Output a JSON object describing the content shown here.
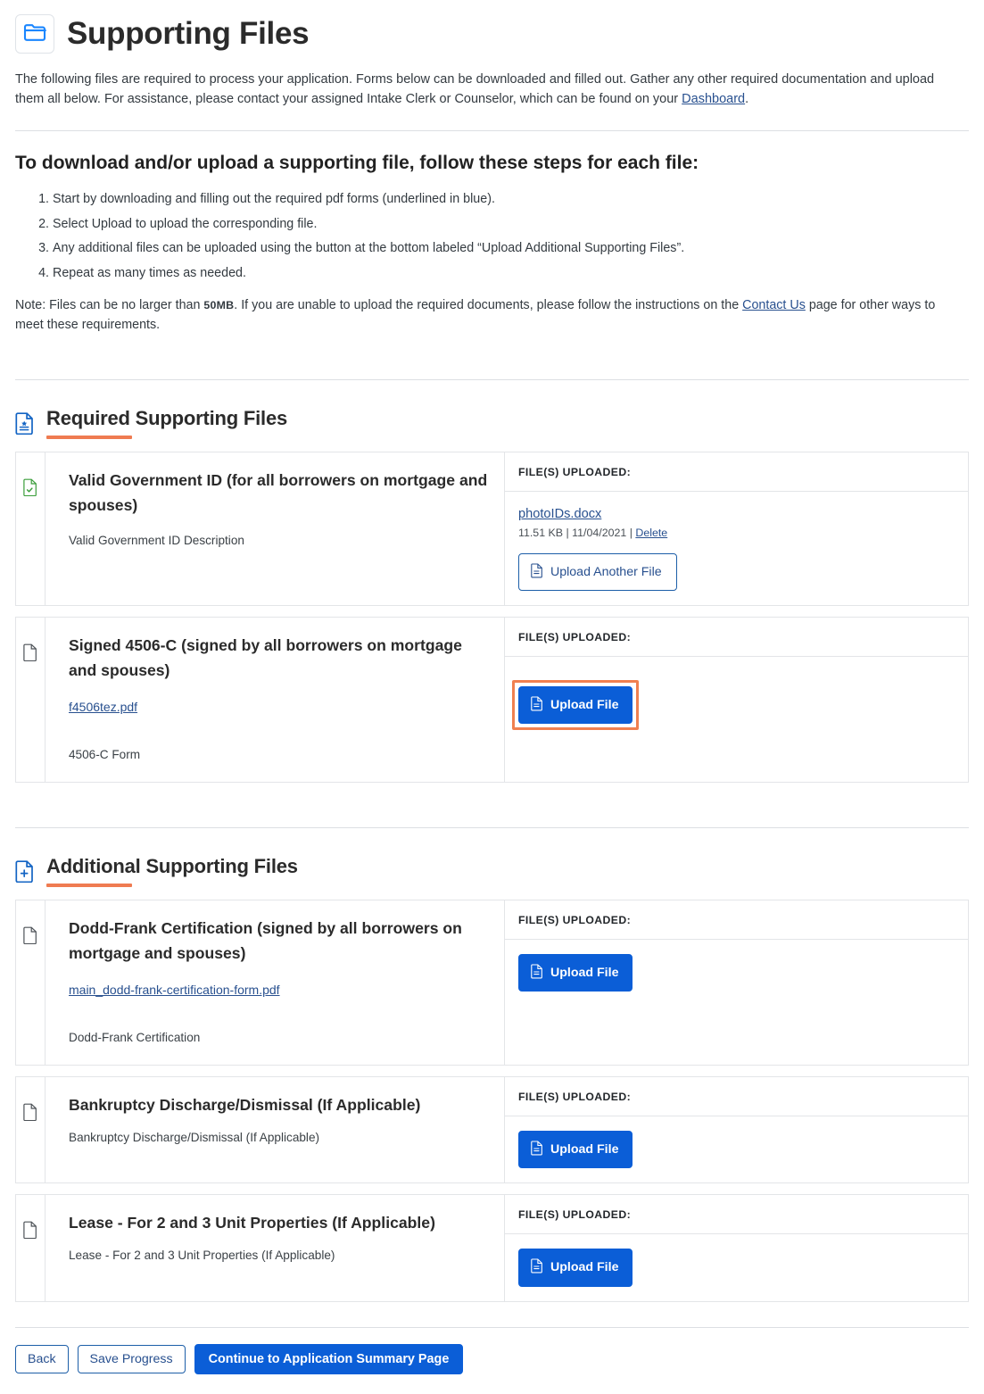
{
  "header": {
    "title": "Supporting Files",
    "icon": "folder-icon"
  },
  "intro": {
    "text_before_link": "The following files are required to process your application. Forms below can be downloaded and filled out. Gather any other required documentation and upload them all below. For assistance, please contact your assigned Intake Clerk or Counselor, which can be found on your ",
    "link_label": "Dashboard",
    "text_after_link": "."
  },
  "steps": {
    "title": "To download and/or upload a supporting file, follow these steps for each file:",
    "items": [
      "Start by downloading and filling out the required pdf forms (underlined in blue).",
      "Select Upload to upload the corresponding file.",
      "Any additional files can be uploaded using the button at the bottom labeled “Upload Additional Supporting Files”.",
      "Repeat as many times as needed."
    ],
    "note_prefix": "Note: Files can be no larger than ",
    "note_size": "50MB",
    "note_middle": ". If you are unable to upload the required documents, please follow the instructions on the ",
    "note_link": "Contact Us",
    "note_suffix": " page for other ways to meet these requirements."
  },
  "sections": [
    {
      "id": "required",
      "title": "Required Supporting Files",
      "icon": "document-required-icon",
      "rows": [
        {
          "status_icon": "document-complete-icon",
          "title": "Valid Government ID (for all borrowers on mortgage and spouses)",
          "form_link": "",
          "description": "Valid Government ID Description",
          "side_header": "FILE(S) UPLOADED:",
          "uploaded": {
            "filename": "photoIDs.docx",
            "size": "11.51 KB",
            "separator1": " | ",
            "date": "11/04/2021",
            "separator2": " | ",
            "delete_label": "Delete"
          },
          "upload_button": "Upload Another File",
          "upload_button_style": "outline",
          "focused": false
        },
        {
          "status_icon": "document-empty-icon",
          "title": "Signed 4506-C (signed by all borrowers on mortgage and spouses)",
          "form_link": "f4506tez.pdf",
          "description": "4506-C Form",
          "side_header": "FILE(S) UPLOADED:",
          "uploaded": null,
          "upload_button": "Upload File",
          "upload_button_style": "primary",
          "focused": true
        }
      ]
    },
    {
      "id": "additional",
      "title": "Additional Supporting Files",
      "icon": "document-add-icon",
      "rows": [
        {
          "status_icon": "document-empty-icon",
          "title": "Dodd-Frank Certification (signed by all borrowers on mortgage and spouses)",
          "form_link": "main_dodd-frank-certification-form.pdf",
          "description": "Dodd-Frank Certification",
          "side_header": "FILE(S) UPLOADED:",
          "uploaded": null,
          "upload_button": "Upload File",
          "upload_button_style": "primary",
          "focused": false
        },
        {
          "status_icon": "document-empty-icon",
          "title": "Bankruptcy Discharge/Dismissal (If Applicable)",
          "form_link": "",
          "description": "Bankruptcy Discharge/Dismissal (If Applicable)",
          "side_header": "FILE(S) UPLOADED:",
          "uploaded": null,
          "upload_button": "Upload File",
          "upload_button_style": "primary",
          "focused": false
        },
        {
          "status_icon": "document-empty-icon",
          "title": "Lease - For 2 and 3 Unit Properties (If Applicable)",
          "form_link": "",
          "description": "Lease - For 2 and 3 Unit Properties (If Applicable)",
          "side_header": "FILE(S) UPLOADED:",
          "uploaded": null,
          "upload_button": "Upload File",
          "upload_button_style": "primary",
          "focused": false
        }
      ]
    }
  ],
  "footer": {
    "back_label": "Back",
    "save_label": "Save Progress",
    "continue_label": "Continue to Application Summary Page"
  },
  "colors": {
    "primary_blue": "#0b5ed7",
    "link_blue": "#28508f",
    "accent_orange": "#ef7b51",
    "focus_orange": "#f08050",
    "success_green": "#3a9d3a",
    "border_gray": "#e3e5e8"
  }
}
